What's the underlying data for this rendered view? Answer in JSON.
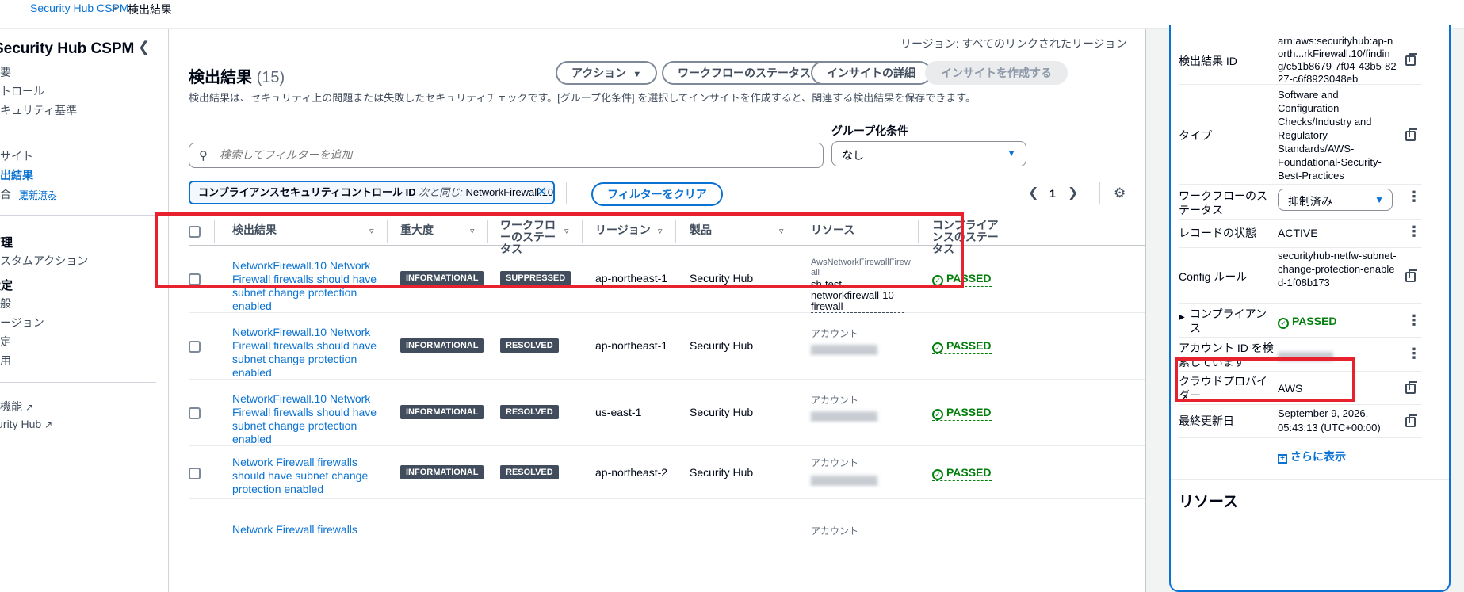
{
  "breadcrumb": {
    "root": "Security Hub CSPM",
    "separator": ">",
    "current": "検出結果"
  },
  "sidebar": {
    "title": "Security Hub CSPM",
    "items": [
      {
        "label": "概要",
        "active": false
      },
      {
        "label": "コントロール",
        "active": false
      },
      {
        "label": "セキュリティ基準",
        "active": false
      },
      {
        "label": "インサイト",
        "active": false
      },
      {
        "label": "検出結果",
        "active": true
      },
      {
        "label": "統合",
        "active": false,
        "badge": "更新済み"
      }
    ],
    "section_manage": "管理",
    "manage_items": [
      "カスタムアクション"
    ],
    "section_settings": "設定",
    "settings_items": [
      "一般",
      "リージョン",
      "設定",
      "使用"
    ],
    "footer_links": [
      "新機能",
      "Security Hub"
    ]
  },
  "main": {
    "region_note": "リージョン: すべてのリンクされたリージョン",
    "title": "検出結果",
    "count": "(15)",
    "buttons": {
      "action": "アクション",
      "workflow_status": "ワークフローのステータス",
      "insight_details": "インサイトの詳細",
      "create_insight": "インサイトを作成する"
    },
    "description": "検出結果は、セキュリティ上の問題または失敗したセキュリティチェックです。[グループ化条件] を選択してインサイトを作成すると、関連する検出結果を保存できます。",
    "search_placeholder": "検索してフィルターを追加",
    "group_by_label": "グループ化条件",
    "group_by_value": "なし",
    "filter_token": {
      "key": "コンプライアンスセキュリティコントロール ID",
      "operator": "次と同じ:",
      "value": "NetworkFirewall.10"
    },
    "clear_filters": "フィルターをクリア",
    "page": "1"
  },
  "table": {
    "columns": [
      "検出結果",
      "重大度",
      "ワークフローのステータス",
      "リージョン",
      "製品",
      "リソース",
      "コンプライアンスのステータス"
    ],
    "rows": [
      {
        "title": "NetworkFirewall.10 Network Firewall firewalls should have subnet change protection enabled",
        "severity": "INFORMATIONAL",
        "workflow": "SUPPRESSED",
        "region": "ap-northeast-1",
        "product": "Security Hub",
        "resource_type": "AwsNetworkFirewallFirewall",
        "resource_name": "sh-test-networkfirewall-10-firewall",
        "compliance": "PASSED"
      },
      {
        "title": "NetworkFirewall.10 Network Firewall firewalls should have subnet change protection enabled",
        "severity": "INFORMATIONAL",
        "workflow": "RESOLVED",
        "region": "ap-northeast-1",
        "product": "Security Hub",
        "resource_type": "アカウント",
        "resource_name": "",
        "compliance": "PASSED"
      },
      {
        "title": "NetworkFirewall.10 Network Firewall firewalls should have subnet change protection enabled",
        "severity": "INFORMATIONAL",
        "workflow": "RESOLVED",
        "region": "us-east-1",
        "product": "Security Hub",
        "resource_type": "アカウント",
        "resource_name": "",
        "compliance": "PASSED"
      },
      {
        "title": "Network Firewall firewalls should have subnet change protection enabled",
        "severity": "INFORMATIONAL",
        "workflow": "RESOLVED",
        "region": "ap-northeast-2",
        "product": "Security Hub",
        "resource_type": "アカウント",
        "resource_name": "",
        "compliance": "PASSED"
      },
      {
        "title": "Network Firewall firewalls",
        "severity": "",
        "workflow": "",
        "region": "",
        "product": "",
        "resource_type": "アカウント",
        "resource_name": "",
        "compliance": ""
      }
    ]
  },
  "detail_panel": {
    "finding_id_label": "検出結果 ID",
    "finding_id": "arn:aws:securityhub:ap-north...rkFirewall.10/finding/c51b8679-7f04-43b5-8227-c6f8923048eb",
    "type_label": "タイプ",
    "type": "Software and Configuration Checks/Industry and Regulatory Standards/AWS-Foundational-Security-Best-Practices",
    "workflow_label": "ワークフローのステータス",
    "workflow_value": "抑制済み",
    "record_state_label": "レコードの状態",
    "record_state": "ACTIVE",
    "config_rule_label": "Config ルール",
    "config_rule": "securityhub-netfw-subnet-change-protection-enabled-1f08b173",
    "compliance_label": "コンプライアンス",
    "compliance": "PASSED",
    "account_search_label": "アカウント ID を検索しています",
    "cloud_provider_label": "クラウドプロバイダー",
    "cloud_provider": "AWS",
    "updated_label": "最終更新日",
    "updated": "September 9, 2026, 05:43:13 (UTC+00:00)",
    "show_more": "さらに表示",
    "resources_heading": "リソース"
  },
  "colors": {
    "link": "#0972d3",
    "passed": "#037f0c",
    "highlight": "#e8212e",
    "badge_bg": "#414d5c"
  }
}
